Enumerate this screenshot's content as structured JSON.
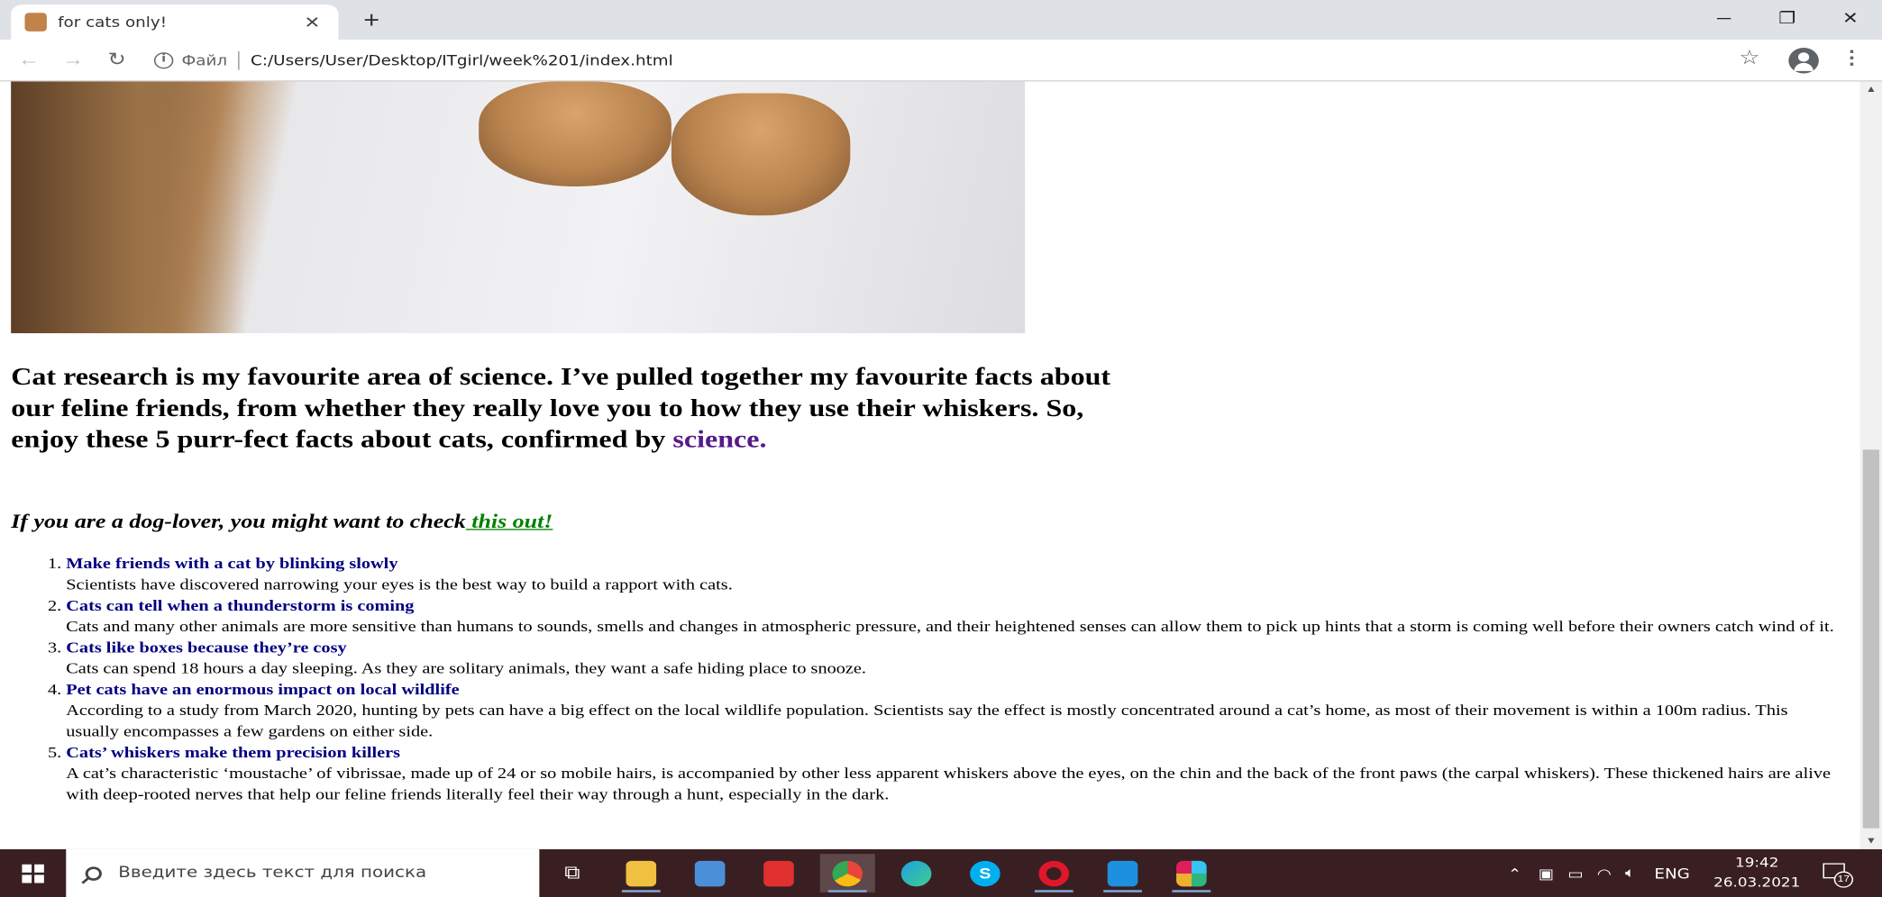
{
  "browser": {
    "tab_title": "for cats only!",
    "new_tab_symbol": "+",
    "security_label": "Файл",
    "url": "C:/Users/User/Desktop/ITgirl/week%201/index.html"
  },
  "page": {
    "intro_text": "Cat research is my favourite area of science. I’ve pulled together my favourite facts about our feline friends, from whether they really love you to how they use their whiskers. So, enjoy these 5 purr-fect facts about cats, confirmed by ",
    "intro_link": "science.",
    "dog_text": "If you are a dog-lover, you might want to check",
    "dog_link": " this out!",
    "facts": [
      {
        "title": "Make friends with a cat by blinking slowly",
        "body": "Scientists have discovered narrowing your eyes is the best way to build a rapport with cats."
      },
      {
        "title": "Cats can tell when a thunderstorm is coming",
        "body": "Cats and many other animals are more sensitive than humans to sounds, smells and changes in atmospheric pressure, and their heightened senses can allow them to pick up hints that a storm is coming well before their owners catch wind of it."
      },
      {
        "title": "Cats like boxes because they’re cosy",
        "body": "Cats can spend 18 hours a day sleeping. As they are solitary animals, they want a safe hiding place to snooze."
      },
      {
        "title": "Pet cats have an enormous impact on local wildlife",
        "body": "According to a study from March 2020, hunting by pets can have a big effect on the local wildlife population. Scientists say the effect is mostly concentrated around a cat’s home, as most of their movement is within a 100m radius. This usually encompasses a few gardens on either side."
      },
      {
        "title": "Cats’ whiskers make them precision killers",
        "body": "A cat’s characteristic ‘moustache’ of vibrissae, made up of 24 or so mobile hairs, is accompanied by other less apparent whiskers above the eyes, on the chin and the back of the front paws (the carpal whiskers). These thickened hairs are alive with deep-rooted nerves that help our feline friends literally feel their way through a hunt, especially in the dark."
      }
    ]
  },
  "taskbar": {
    "search_placeholder": "Введите здесь текст для поиска",
    "language": "ENG",
    "time": "19:42",
    "date": "26.03.2021",
    "notification_count": "17",
    "apps": [
      {
        "name": "task-view",
        "color": "#3a1f22"
      },
      {
        "name": "file-explorer",
        "color": "#f0c040"
      },
      {
        "name": "microsoft-store",
        "color": "#4a90d9"
      },
      {
        "name": "gift-app",
        "color": "#e03030"
      },
      {
        "name": "chrome",
        "color": "#e8453c"
      },
      {
        "name": "edge",
        "color": "#1fa0e0"
      },
      {
        "name": "skype",
        "color": "#00aff0"
      },
      {
        "name": "opera",
        "color": "#e0162b"
      },
      {
        "name": "vs-code",
        "color": "#1e90e0"
      },
      {
        "name": "slack",
        "color": "#ecb22e"
      }
    ]
  },
  "colors": {
    "link_visited": "#551a8b",
    "link_green": "#008000",
    "fact_title": "#000080",
    "taskbar_bg": "#3a1f22"
  }
}
